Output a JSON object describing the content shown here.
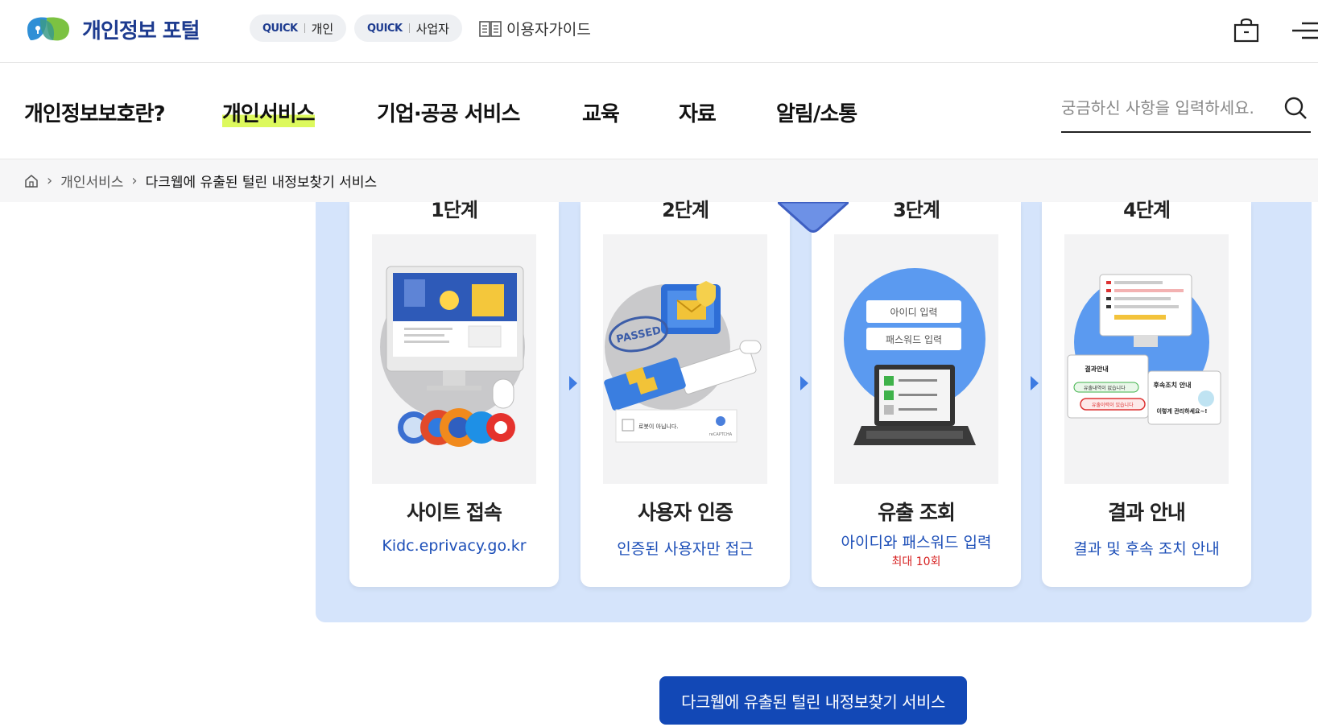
{
  "header": {
    "logo_text": "개인정보 포털",
    "quick_personal": {
      "tag": "QUICK",
      "label": "개인"
    },
    "quick_business": {
      "tag": "QUICK",
      "label": "사업자"
    },
    "guide_label": "이용자가이드",
    "icons": [
      "bag-icon",
      "menu-icon",
      "book-icon"
    ]
  },
  "gnb": {
    "items": [
      {
        "label": "개인정보보호란?",
        "active": false
      },
      {
        "label": "개인서비스",
        "active": true
      },
      {
        "label": "기업·공공 서비스",
        "active": false
      },
      {
        "label": "교육",
        "active": false
      },
      {
        "label": "자료",
        "active": false
      },
      {
        "label": "알림/소통",
        "active": false
      }
    ],
    "search_placeholder": "궁금하신 사항을 입력하세요.",
    "highlight_color": "#ddf95d"
  },
  "breadcrumb": {
    "items": [
      "개인서비스",
      "다크웹에 유출된 털린 내정보찾기 서비스"
    ]
  },
  "steps": [
    {
      "label": "1단계",
      "title": "사이트 접속",
      "desc": "Kidc.eprivacy.go.kr",
      "note": ""
    },
    {
      "label": "2단계",
      "title": "사용자 인증",
      "desc": "인증된 사용자만 접근",
      "note": "",
      "illus_texts": {
        "stamp": "PASSED",
        "captcha": "로봇이 아닙니다.",
        "recaptcha": "reCAPTCHA"
      }
    },
    {
      "label": "3단계",
      "title": "유출 조회",
      "desc": "아이디와 패스워드 입력",
      "note": "최대 10회",
      "illus_texts": {
        "id_field": "아이디 입력",
        "pw_field": "패스워드 입력"
      }
    },
    {
      "label": "4단계",
      "title": "결과 안내",
      "desc": "결과 및 후속 조치 안내",
      "note": "",
      "illus_texts": {
        "result": "결과안내",
        "ok": "유출내역이 없습니다",
        "warn": "유출이력이 있습니다",
        "follow": "후속조치 안내",
        "tip": "이렇게 관리하세요~!"
      }
    }
  ],
  "cta_label": "다크웹에 유출된 털린 내정보찾기 서비스",
  "colors": {
    "brand": "#1d3b8f",
    "panel_bg": "#d5e4fb",
    "cta_bg": "#1248b6",
    "link_blue": "#1d4fb8",
    "note_red": "#d62020"
  }
}
